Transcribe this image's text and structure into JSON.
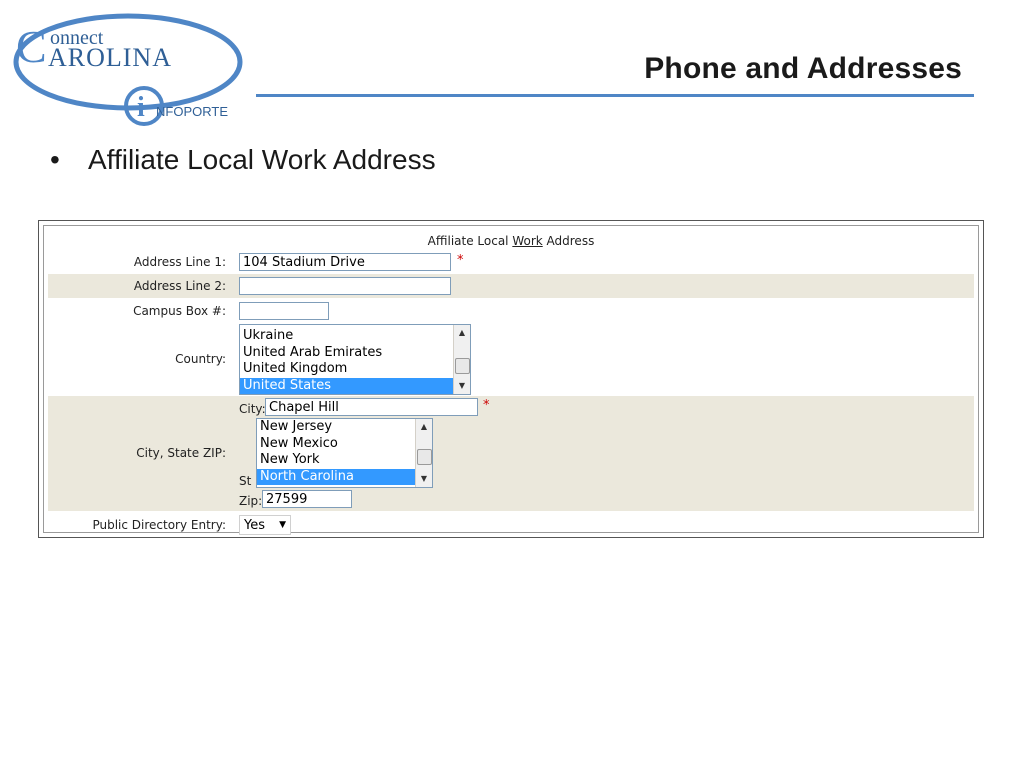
{
  "slide": {
    "title": "Phone and Addresses",
    "bullet": "Affiliate Local Work Address",
    "logo": {
      "line1": "onnect",
      "line2": "AROLINA",
      "initial": "C",
      "badge": "NFOPORTE",
      "badge_initial": "i"
    }
  },
  "form": {
    "caption_pre": "Affiliate Local ",
    "caption_link": "Work",
    "caption_post": " Address",
    "address1": {
      "label": "Address Line 1:",
      "value": "104 Stadium Drive",
      "required": "*"
    },
    "address2": {
      "label": "Address Line 2:",
      "value": ""
    },
    "campus_box": {
      "label": "Campus Box #:",
      "value": ""
    },
    "country": {
      "label": "Country:",
      "options": [
        "Ukraine",
        "United Arab Emirates",
        "United Kingdom",
        "United States"
      ],
      "selected": "United States"
    },
    "city_state_zip": {
      "label": "City, State ZIP:",
      "city_label": "City:",
      "city_value": "Chapel Hill",
      "required": "*",
      "state_label": "St",
      "state_options": [
        "New Jersey",
        "New Mexico",
        "New York",
        "North Carolina"
      ],
      "state_selected": "North Carolina",
      "zip_label": "Zip:",
      "zip_value": "27599"
    },
    "public_directory": {
      "label": "Public Directory Entry:",
      "value": "Yes"
    }
  },
  "colors": {
    "accent_rule": "#4f86c6",
    "selected": "#3399ff",
    "row_shade": "#ebe8dc"
  },
  "icons": {
    "scroll_up": "up-arrow-icon",
    "scroll_down": "down-arrow-icon",
    "dropdown": "caret-down-icon"
  }
}
